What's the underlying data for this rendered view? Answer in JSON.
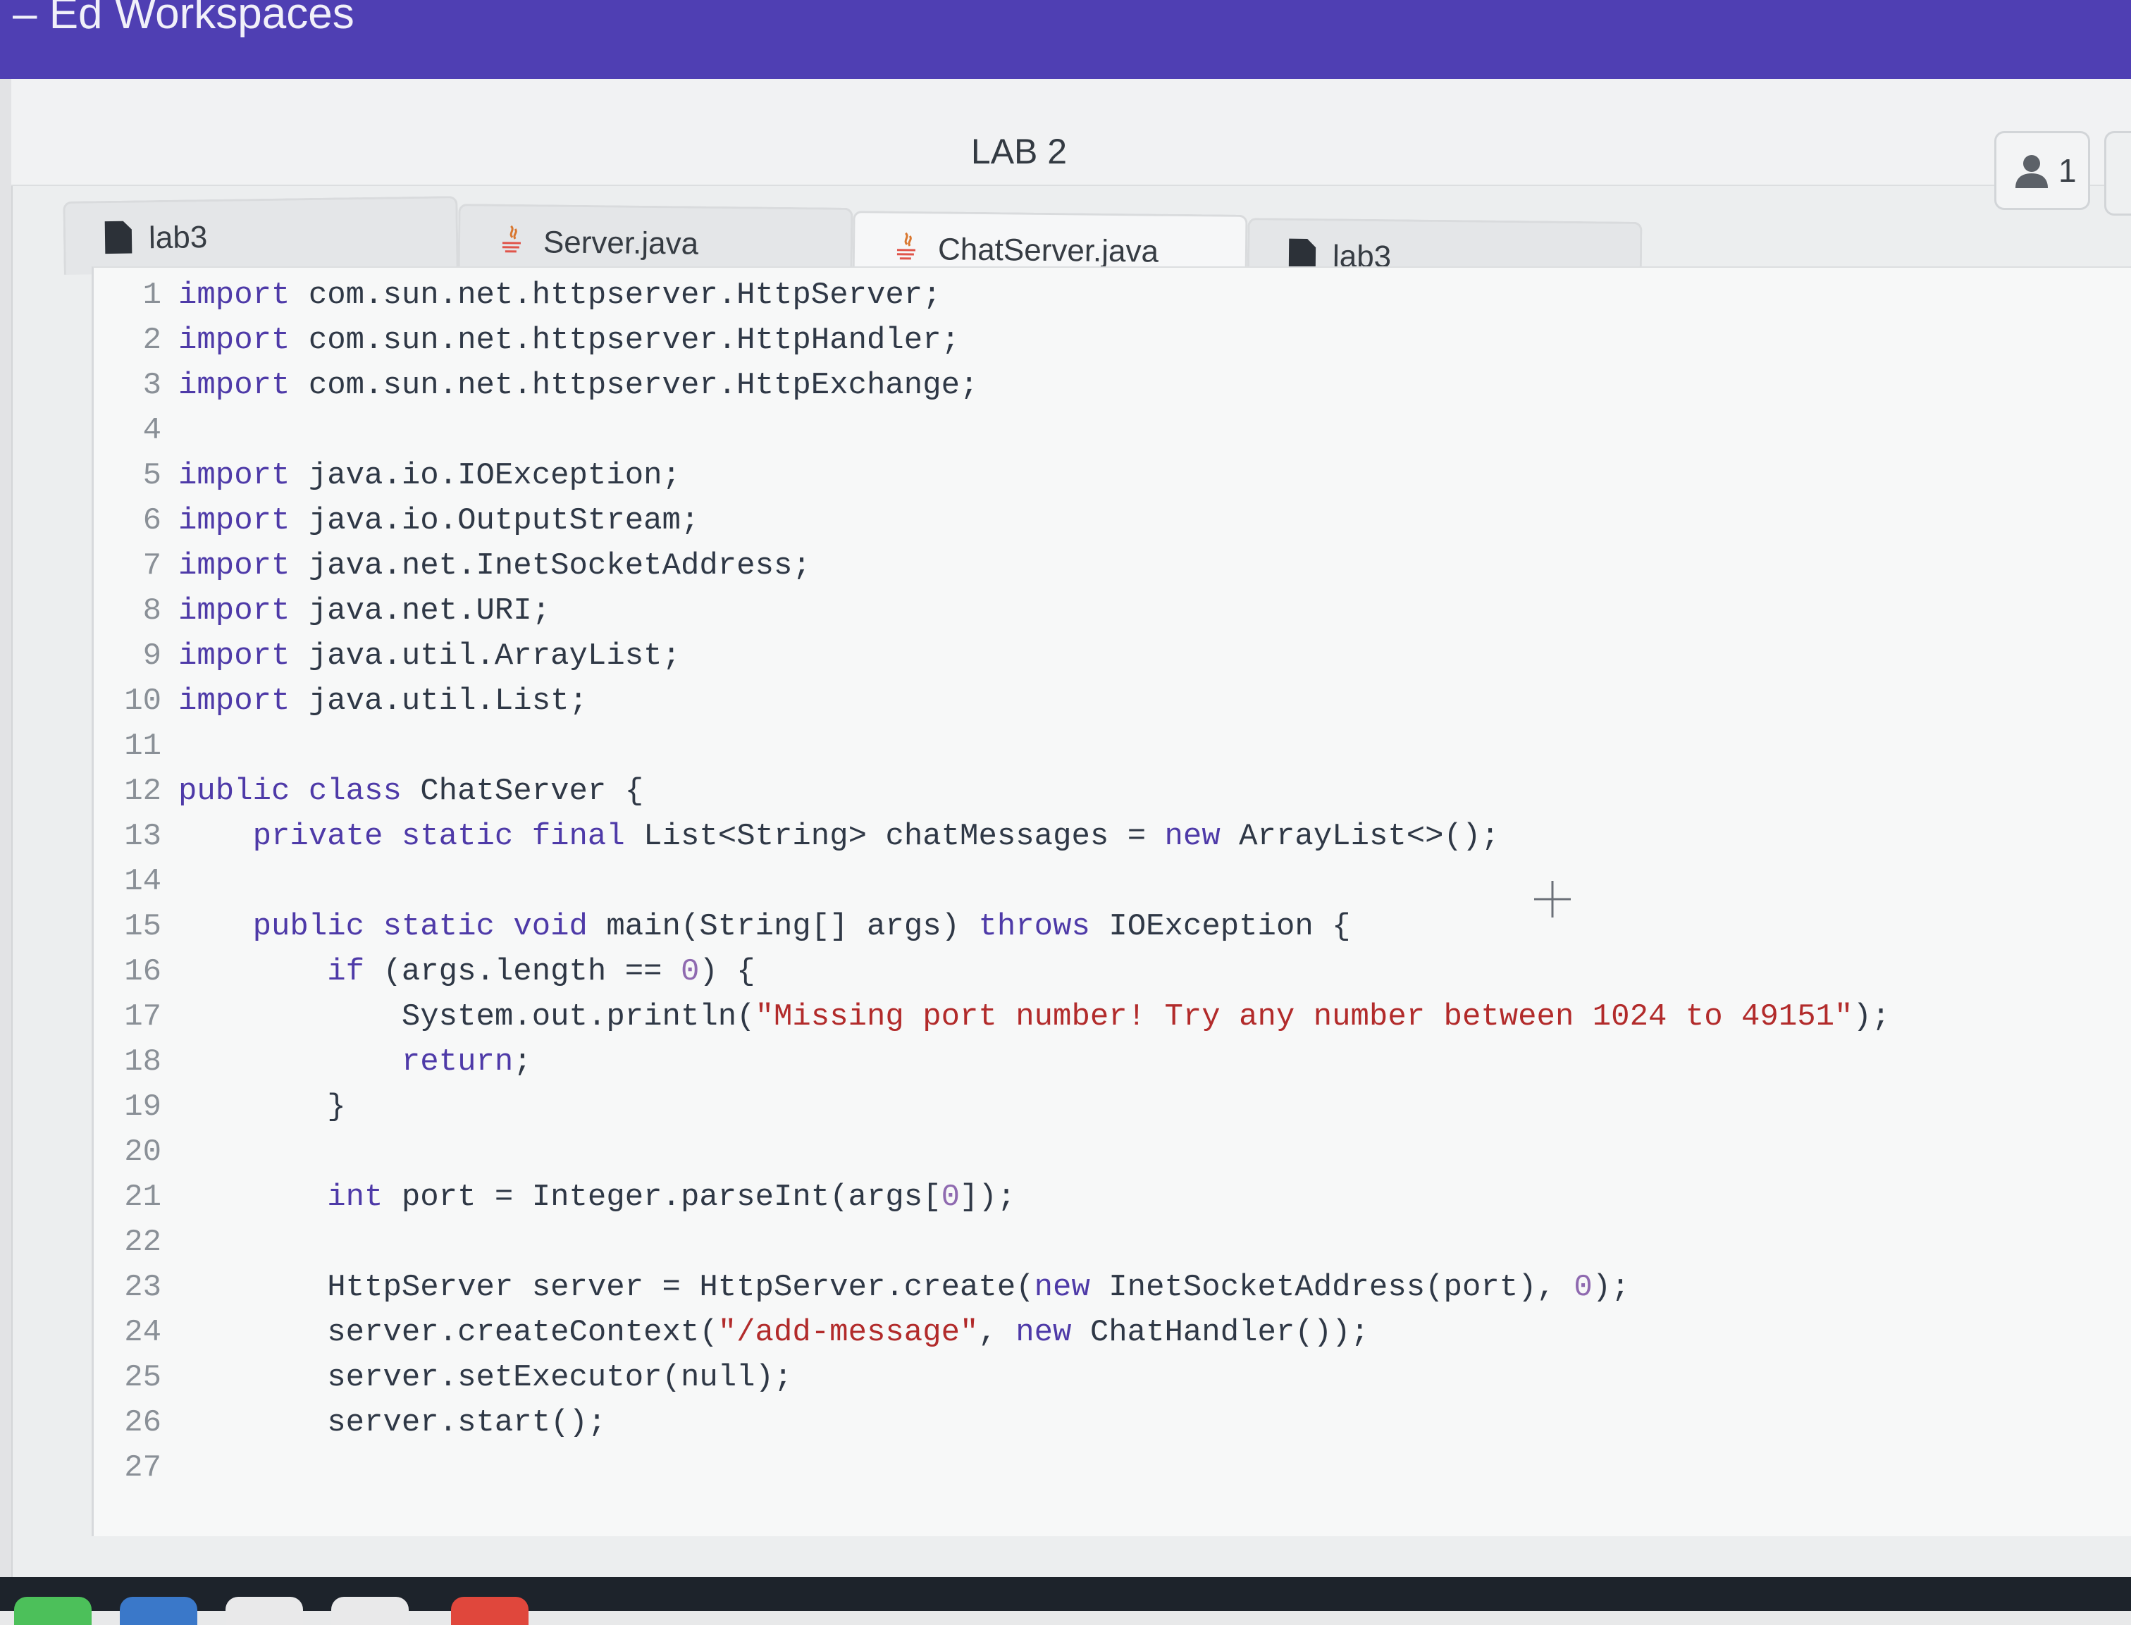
{
  "app": {
    "title": "– Ed Workspaces"
  },
  "workspace": {
    "title": "LAB 2",
    "user_count": "1"
  },
  "tabs": [
    {
      "label": "lab3",
      "icon": "file-icon"
    },
    {
      "label": "Server.java",
      "icon": "java-icon"
    },
    {
      "label": "ChatServer.java",
      "icon": "java-icon"
    },
    {
      "label": "lab3",
      "icon": "file-icon"
    }
  ],
  "editor": {
    "lines": [
      {
        "num": "1",
        "text": "import com.sun.net.httpserver.HttpServer;"
      },
      {
        "num": "2",
        "text": "import com.sun.net.httpserver.HttpHandler;"
      },
      {
        "num": "3",
        "text": "import com.sun.net.httpserver.HttpExchange;"
      },
      {
        "num": "4",
        "text": ""
      },
      {
        "num": "5",
        "text": "import java.io.IOException;"
      },
      {
        "num": "6",
        "text": "import java.io.OutputStream;"
      },
      {
        "num": "7",
        "text": "import java.net.InetSocketAddress;"
      },
      {
        "num": "8",
        "text": "import java.net.URI;"
      },
      {
        "num": "9",
        "text": "import java.util.ArrayList;"
      },
      {
        "num": "10",
        "text": "import java.util.List;"
      },
      {
        "num": "11",
        "text": ""
      },
      {
        "num": "12",
        "text": "public class ChatServer {"
      },
      {
        "num": "13",
        "text": "    private static final List<String> chatMessages = new ArrayList<>();"
      },
      {
        "num": "14",
        "text": ""
      },
      {
        "num": "15",
        "text": "    public static void main(String[] args) throws IOException {"
      },
      {
        "num": "16",
        "text": "        if (args.length == 0) {"
      },
      {
        "num": "17",
        "text": "            System.out.println(\"Missing port number! Try any number between 1024 to 49151\");"
      },
      {
        "num": "18",
        "text": "            return;"
      },
      {
        "num": "19",
        "text": "        }"
      },
      {
        "num": "20",
        "text": ""
      },
      {
        "num": "21",
        "text": "        int port = Integer.parseInt(args[0]);"
      },
      {
        "num": "22",
        "text": ""
      },
      {
        "num": "23",
        "text": "        HttpServer server = HttpServer.create(new InetSocketAddress(port), 0);"
      },
      {
        "num": "24",
        "text": "        server.createContext(\"/add-message\", new ChatHandler());"
      },
      {
        "num": "25",
        "text": "        server.setExecutor(null);"
      },
      {
        "num": "26",
        "text": "        server.start();"
      },
      {
        "num": "27",
        "text": ""
      }
    ]
  },
  "colors": {
    "topbar": "#4f3fb3",
    "keyword": "#4e3aa8",
    "string": "#b22b2b",
    "number": "#8f6ab0"
  }
}
